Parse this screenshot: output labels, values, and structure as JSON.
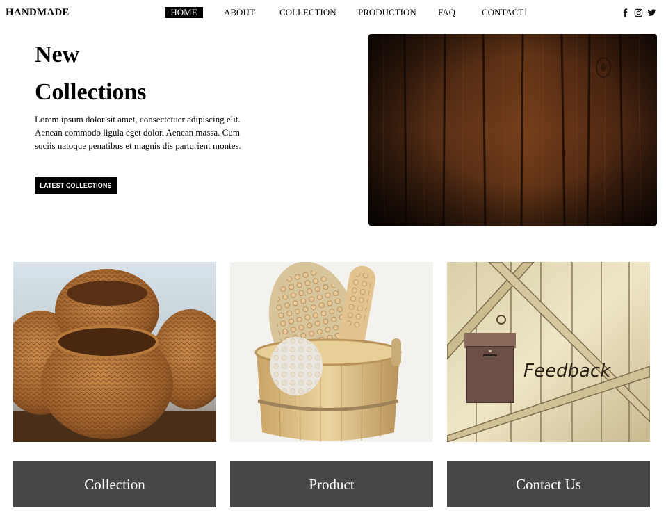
{
  "header": {
    "brand": "HANDMADE",
    "nav": [
      {
        "label": "HOME",
        "active": true
      },
      {
        "label": "ABOUT",
        "active": false
      },
      {
        "label": "COLLECTION",
        "active": false
      },
      {
        "label": "PRODUCTION",
        "active": false
      },
      {
        "label": "FAQ",
        "active": false
      },
      {
        "label": "CONTACT",
        "active": false
      }
    ],
    "social_icons": [
      "facebook-icon",
      "instagram-icon",
      "twitter-icon"
    ]
  },
  "hero": {
    "title_line1": "New",
    "title_line2": "Collections",
    "body": "Lorem ipsum dolor sit amet, consectetuer adipiscing elit. Aenean commodo ligula eget dolor. Aenean massa. Cum sociis natoque penatibus et magnis dis parturient montes.",
    "cta_label": "LATEST COLLECTIONS",
    "image": "dark-wood-planks"
  },
  "cards": [
    {
      "image": "wicker-baskets",
      "label": "Collection"
    },
    {
      "image": "wooden-bath-bucket-brushes",
      "label": "Product"
    },
    {
      "image": "mailbox-on-wooden-door",
      "image_text": "Feedback",
      "label": "Contact Us"
    }
  ],
  "colors": {
    "accent": "#000000",
    "card_button_bg": "#474747",
    "text_on_dark": "#ffffff"
  }
}
